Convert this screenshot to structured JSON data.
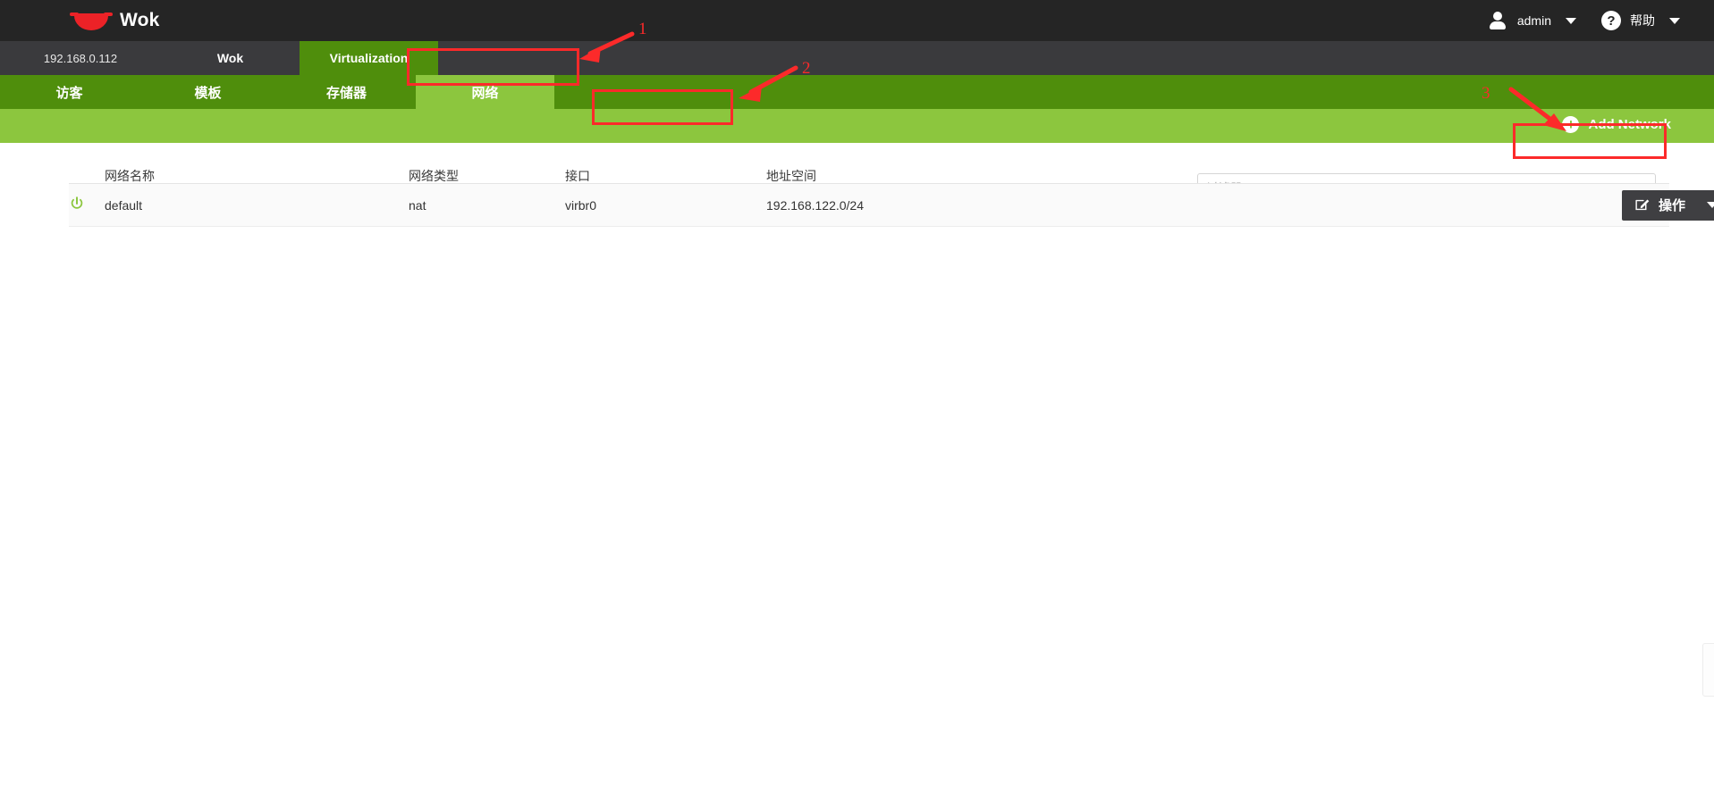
{
  "header": {
    "brand": "Wok",
    "logo_icon": "wok-logo-icon",
    "user": {
      "icon": "user-icon",
      "label": "admin",
      "caret_icon": "chevron-down-icon"
    },
    "help": {
      "icon": "question-mark-icon",
      "label": "帮助",
      "caret_icon": "chevron-down-icon"
    }
  },
  "app_nav": {
    "host": "192.168.0.112",
    "items": [
      {
        "label": "Wok",
        "active": false
      },
      {
        "label": "Virtualization",
        "active": true
      }
    ]
  },
  "tabs": [
    {
      "label": "访客",
      "active": false
    },
    {
      "label": "模板",
      "active": false
    },
    {
      "label": "存储器",
      "active": false
    },
    {
      "label": "网络",
      "active": true
    }
  ],
  "toolbar": {
    "add_label": "Add Network",
    "add_icon": "plus-circle-icon"
  },
  "filter": {
    "placeholder": "过滤器",
    "value": ""
  },
  "table": {
    "columns": [
      {
        "key": "state",
        "label": ""
      },
      {
        "key": "name",
        "label": "网络名称"
      },
      {
        "key": "type",
        "label": "网络类型"
      },
      {
        "key": "interface",
        "label": "接口"
      },
      {
        "key": "address",
        "label": "地址空间"
      },
      {
        "key": "action",
        "label": ""
      }
    ],
    "rows": [
      {
        "state_icon": "power-on-icon",
        "name": "default",
        "type": "nat",
        "interface": "virbr0",
        "address": "192.168.122.0/24",
        "action_label": "操作",
        "action_icon": "edit-pencil-icon",
        "action_caret_icon": "chevron-down-icon"
      }
    ]
  },
  "annotations": [
    {
      "number": "1",
      "target": "Virtualization"
    },
    {
      "number": "2",
      "target": "网络"
    },
    {
      "number": "3",
      "target": "Add Network"
    }
  ],
  "colors": {
    "header_bg": "#252525",
    "appnav_bg": "#3a3a3d",
    "green_dark": "#4f8e0c",
    "green_light": "#8cc63e",
    "annotation_red": "#fc2a2a",
    "action_bg": "#3f3f42",
    "power_on": "#8cc63e"
  }
}
